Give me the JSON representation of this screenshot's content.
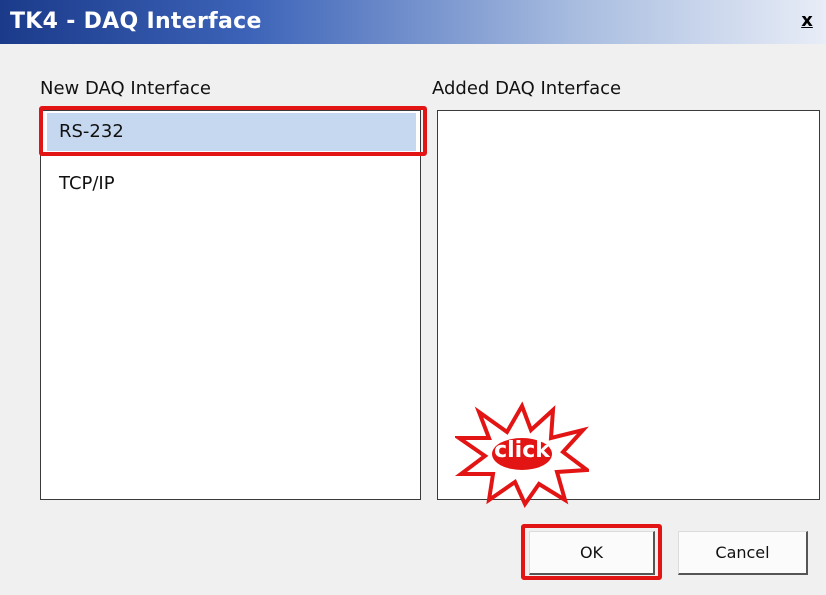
{
  "window": {
    "title": "TK4 - DAQ Interface",
    "close_glyph": "x"
  },
  "labels": {
    "new_interface": "New DAQ Interface",
    "added_interface": "Added DAQ Interface"
  },
  "new_list": {
    "items": [
      {
        "label": "RS-232",
        "selected": true
      },
      {
        "label": "TCP/IP",
        "selected": false
      }
    ]
  },
  "added_list": {
    "items": []
  },
  "buttons": {
    "ok": "OK",
    "cancel": "Cancel"
  },
  "annotation": {
    "callout_text": "click",
    "highlight_color": "#e21414"
  },
  "colors": {
    "title_bar_start": "#1b3a8a",
    "selection_bg": "#c6d8f0",
    "window_bg": "#f0f0f0"
  }
}
